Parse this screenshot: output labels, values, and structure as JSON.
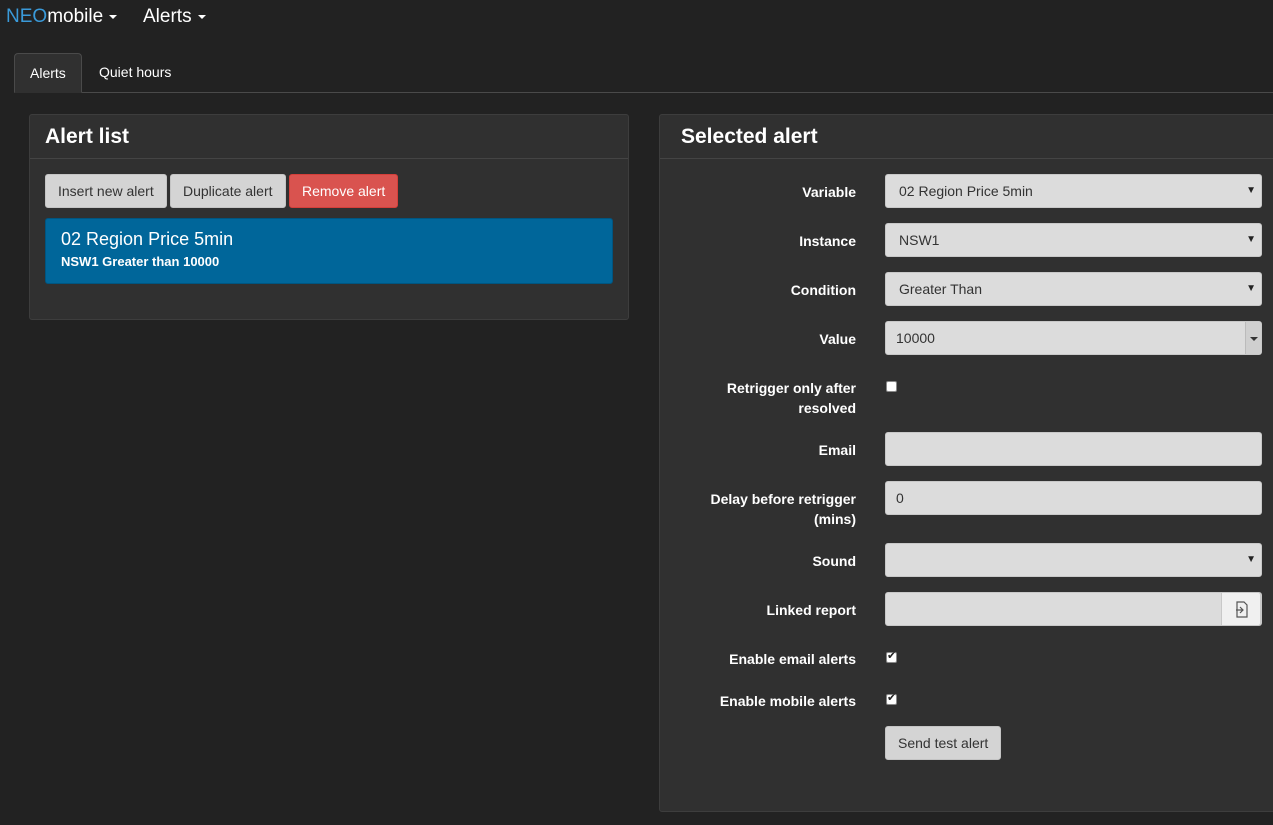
{
  "nav": {
    "brand_prefix": "NEO",
    "brand_suffix": "mobile",
    "menu_label": "Alerts"
  },
  "tabs": [
    {
      "label": "Alerts",
      "active": true
    },
    {
      "label": "Quiet hours",
      "active": false
    }
  ],
  "alert_list": {
    "title": "Alert list",
    "buttons": {
      "insert": "Insert new alert",
      "duplicate": "Duplicate alert",
      "remove": "Remove alert"
    },
    "items": [
      {
        "title": "02 Region Price 5min",
        "subtitle": "NSW1 Greater than 10000",
        "selected": true
      }
    ]
  },
  "selected_alert": {
    "title": "Selected alert",
    "variable": {
      "label": "Variable",
      "value": "02 Region Price 5min"
    },
    "instance": {
      "label": "Instance",
      "value": "NSW1"
    },
    "condition": {
      "label": "Condition",
      "value": "Greater Than"
    },
    "value": {
      "label": "Value",
      "value": "10000"
    },
    "retrigger_after_resolved": {
      "label_line1": "Retrigger only after",
      "label_line2": "resolved",
      "checked": false
    },
    "email": {
      "label": "Email",
      "value": ""
    },
    "delay": {
      "label_line1": "Delay before retrigger",
      "label_line2": "(mins)",
      "value": "0"
    },
    "sound": {
      "label": "Sound",
      "value": ""
    },
    "linked_report": {
      "label": "Linked report",
      "value": ""
    },
    "enable_email": {
      "label": "Enable email alerts",
      "checked": true
    },
    "enable_mobile": {
      "label": "Enable mobile alerts",
      "checked": true
    },
    "send_test_label": "Send test alert"
  },
  "colors": {
    "background": "#222222",
    "panel": "#303030",
    "accent_blue": "#00669a",
    "brand_blue": "#3a9ad9",
    "danger": "#d9534f"
  },
  "icons": {
    "dropdown_caret": "caret-down-icon",
    "select_arrow": "select-arrow-icon",
    "linked_report_button": "open-file-icon",
    "checkbox_tick": "check-icon"
  }
}
